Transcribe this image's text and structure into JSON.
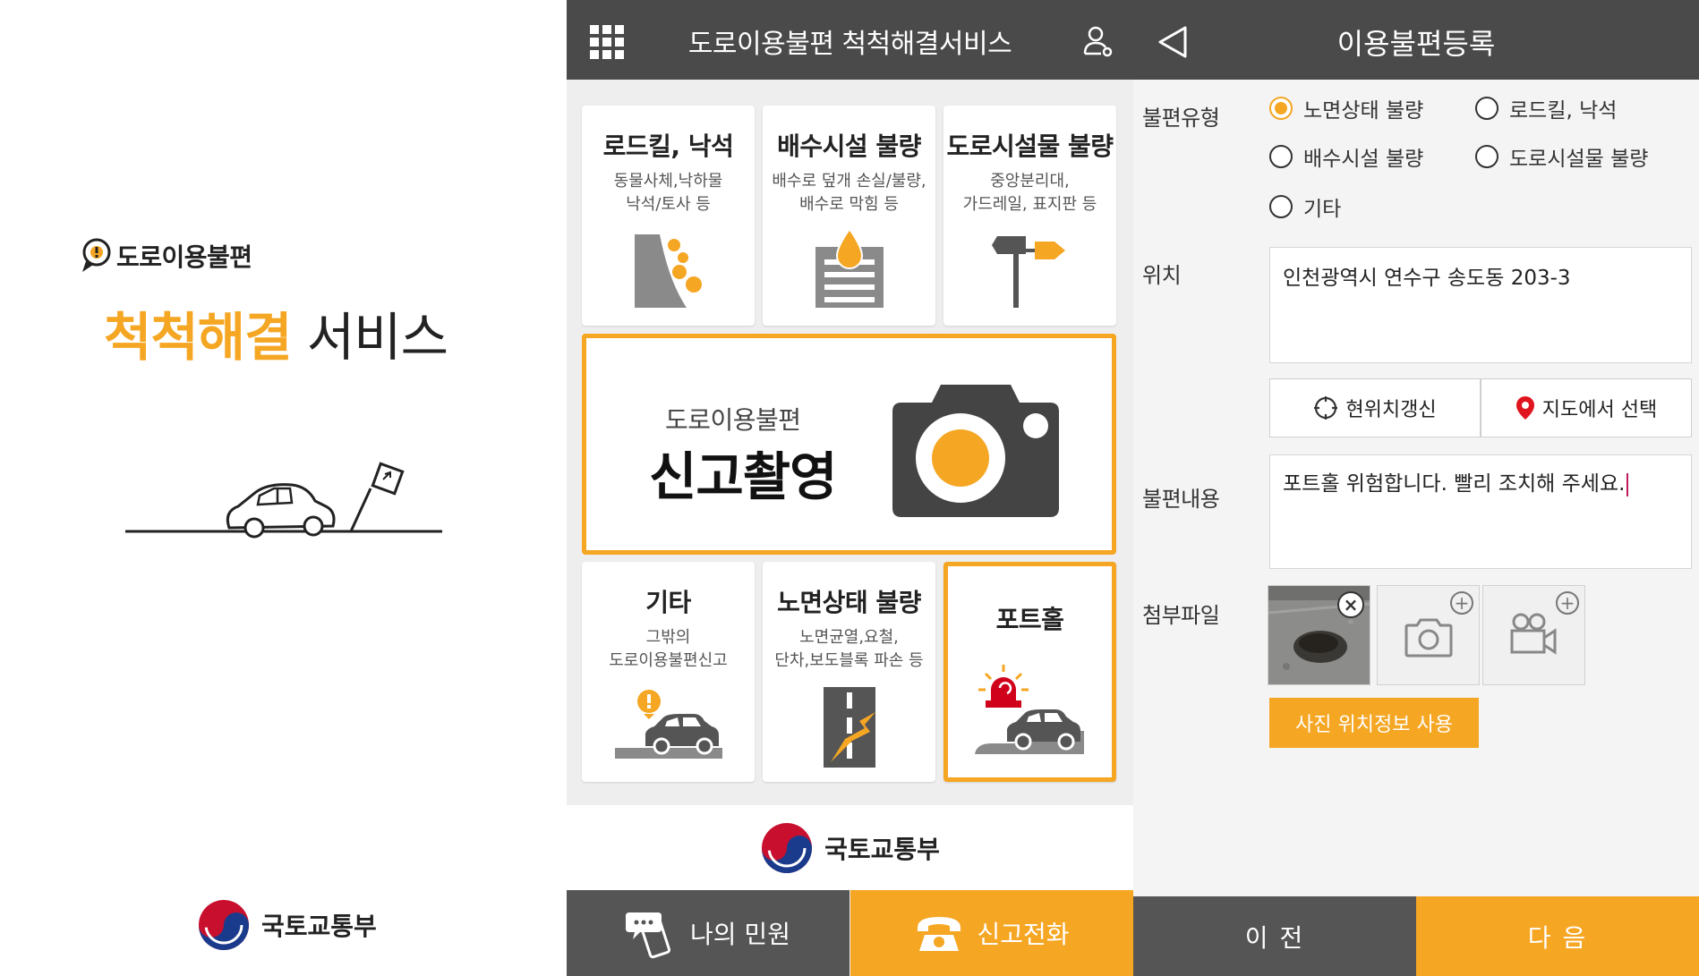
{
  "splash": {
    "sub_title": "도로이용불편",
    "title_highlight": "척척해결",
    "title_rest": " 서비스",
    "ministry": "국토교통부"
  },
  "menu": {
    "header_title": "도로이용불편 척척해결서비스",
    "tiles": [
      {
        "title": "로드킬, 낙석",
        "desc": "동물사체,낙하물\n낙석/토사 등"
      },
      {
        "title": "배수시설 불량",
        "desc": "배수로 덮개 손실/불량,\n배수로 막힘 등"
      },
      {
        "title": "도로시설물 불량",
        "desc": "중앙분리대,\n가드레일, 표지판 등"
      },
      {
        "title": "기타",
        "desc": "그밖의\n도로이용불편신고"
      },
      {
        "title": "노면상태 불량",
        "desc": "노면균열,요철,\n단차,보도블록 파손 등"
      },
      {
        "title": "포트홀",
        "desc": ""
      }
    ],
    "report": {
      "sub": "도로이용불편",
      "main": "신고촬영"
    },
    "ministry": "국토교통부",
    "bottom": {
      "my_complaints": "나의 민원",
      "report_call": "신고전화"
    },
    "colors": {
      "accent": "#f5a623",
      "bar": "#4a4a4a"
    }
  },
  "form": {
    "header_title": "이용불편등록",
    "labels": {
      "type": "불편유형",
      "location": "위치",
      "content": "불편내용",
      "attach": "첨부파일"
    },
    "types": [
      {
        "label": "노면상태 불량",
        "selected": true
      },
      {
        "label": "로드킬, 낙석",
        "selected": false
      },
      {
        "label": "배수시설 불량",
        "selected": false
      },
      {
        "label": "도로시설물 불량",
        "selected": false
      },
      {
        "label": "기타",
        "selected": false
      }
    ],
    "location_value": "인천광역시 연수구 송도동 203-3",
    "refresh_location": "현위치갱신",
    "select_on_map": "지도에서 선택",
    "content_value": "포트홀 위험합니다. 빨리 조치해 주세요.",
    "use_photo_location": "사진 위치정보 사용",
    "prev": "이 전",
    "next": "다 음"
  }
}
